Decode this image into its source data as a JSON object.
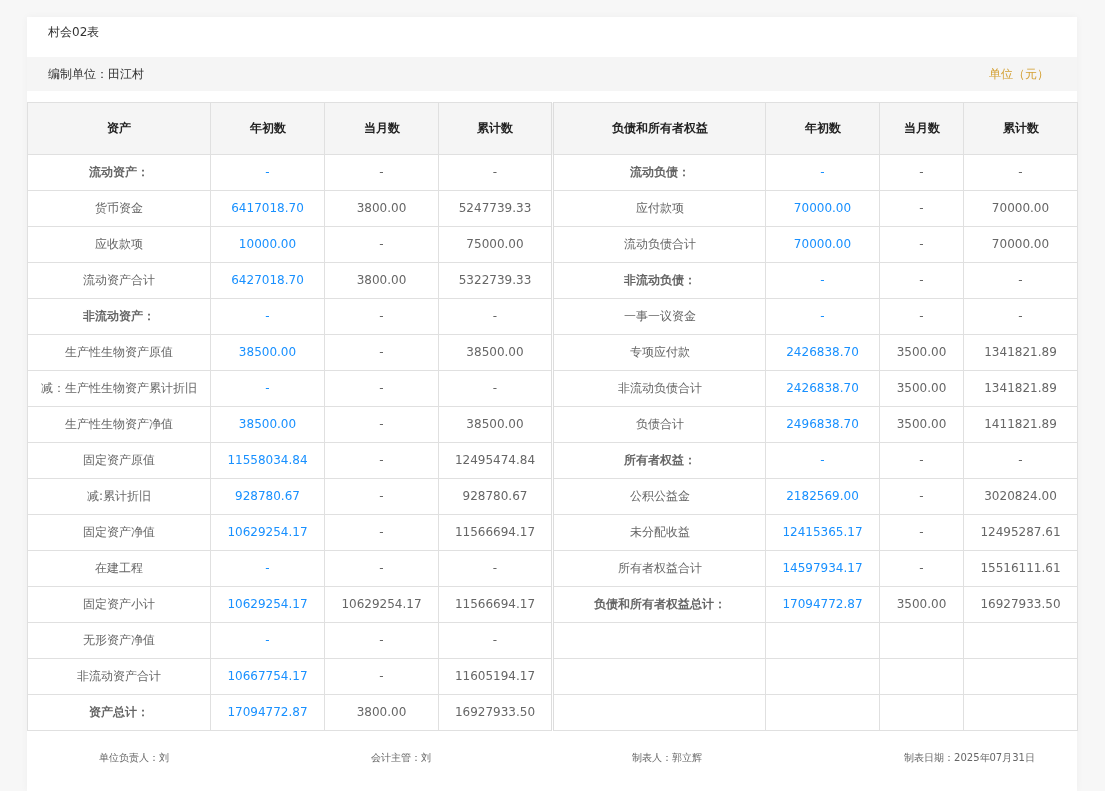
{
  "form_code": "村会02表",
  "unit_bar": {
    "org": "编制单位：田江村",
    "unit": "单位（元）"
  },
  "table": {
    "columns": [
      "资产",
      "年初数",
      "当月数",
      "累计数",
      "负债和所有者权益",
      "年初数",
      "当月数",
      "累计数"
    ],
    "rows": [
      {
        "left": {
          "label": "流动资产：",
          "bold": true,
          "values": [
            "-",
            "-",
            "-"
          ]
        },
        "right": {
          "label": "流动负债：",
          "bold": true,
          "values": [
            "-",
            "-",
            "-"
          ]
        }
      },
      {
        "left": {
          "label": "货币资金",
          "bold": false,
          "values": [
            "6417018.70",
            "3800.00",
            "5247739.33"
          ]
        },
        "right": {
          "label": "应付款项",
          "bold": false,
          "values": [
            "70000.00",
            "-",
            "70000.00"
          ]
        }
      },
      {
        "left": {
          "label": "应收款项",
          "bold": false,
          "values": [
            "10000.00",
            "-",
            "75000.00"
          ]
        },
        "right": {
          "label": "流动负债合计",
          "bold": false,
          "values": [
            "70000.00",
            "-",
            "70000.00"
          ]
        }
      },
      {
        "left": {
          "label": "流动资产合计",
          "bold": false,
          "values": [
            "6427018.70",
            "3800.00",
            "5322739.33"
          ]
        },
        "right": {
          "label": "非流动负债：",
          "bold": true,
          "values": [
            "-",
            "-",
            "-"
          ]
        }
      },
      {
        "left": {
          "label": "非流动资产：",
          "bold": true,
          "values": [
            "-",
            "-",
            "-"
          ]
        },
        "right": {
          "label": "一事一议资金",
          "bold": false,
          "values": [
            "-",
            "-",
            "-"
          ]
        }
      },
      {
        "left": {
          "label": "生产性生物资产原值",
          "bold": false,
          "values": [
            "38500.00",
            "-",
            "38500.00"
          ]
        },
        "right": {
          "label": "专项应付款",
          "bold": false,
          "values": [
            "2426838.70",
            "3500.00",
            "1341821.89"
          ]
        }
      },
      {
        "left": {
          "label": "减：生产性生物资产累计折旧",
          "bold": false,
          "values": [
            "-",
            "-",
            "-"
          ]
        },
        "right": {
          "label": "非流动负债合计",
          "bold": false,
          "values": [
            "2426838.70",
            "3500.00",
            "1341821.89"
          ]
        }
      },
      {
        "left": {
          "label": "生产性生物资产净值",
          "bold": false,
          "values": [
            "38500.00",
            "-",
            "38500.00"
          ]
        },
        "right": {
          "label": "负债合计",
          "bold": false,
          "values": [
            "2496838.70",
            "3500.00",
            "1411821.89"
          ]
        }
      },
      {
        "left": {
          "label": "固定资产原值",
          "bold": false,
          "values": [
            "11558034.84",
            "-",
            "12495474.84"
          ]
        },
        "right": {
          "label": "所有者权益：",
          "bold": true,
          "values": [
            "-",
            "-",
            "-"
          ]
        }
      },
      {
        "left": {
          "label": "减:累计折旧",
          "bold": false,
          "values": [
            "928780.67",
            "-",
            "928780.67"
          ]
        },
        "right": {
          "label": "公积公益金",
          "bold": false,
          "values": [
            "2182569.00",
            "-",
            "3020824.00"
          ]
        }
      },
      {
        "left": {
          "label": "固定资产净值",
          "bold": false,
          "values": [
            "10629254.17",
            "-",
            "11566694.17"
          ]
        },
        "right": {
          "label": "未分配收益",
          "bold": false,
          "values": [
            "12415365.17",
            "-",
            "12495287.61"
          ]
        }
      },
      {
        "left": {
          "label": "在建工程",
          "bold": false,
          "values": [
            "-",
            "-",
            "-"
          ]
        },
        "right": {
          "label": "所有者权益合计",
          "bold": false,
          "values": [
            "14597934.17",
            "-",
            "15516111.61"
          ]
        }
      },
      {
        "left": {
          "label": "固定资产小计",
          "bold": false,
          "values": [
            "10629254.17",
            "10629254.17",
            "11566694.17"
          ]
        },
        "right": {
          "label": "负债和所有者权益总计：",
          "bold": true,
          "values": [
            "17094772.87",
            "3500.00",
            "16927933.50"
          ]
        }
      },
      {
        "left": {
          "label": "无形资产净值",
          "bold": false,
          "values": [
            "-",
            "-",
            "-"
          ]
        }
      },
      {
        "left": {
          "label": "非流动资产合计",
          "bold": false,
          "values": [
            "10667754.17",
            "-",
            "11605194.17"
          ]
        }
      },
      {
        "left": {
          "label": "资产总计：",
          "bold": true,
          "values": [
            "17094772.87",
            "3800.00",
            "16927933.50"
          ]
        }
      }
    ]
  },
  "footer": [
    "单位负责人：刘",
    "会计主管：刘",
    "制表人：郭立辉",
    "制表日期：2025年07月31日"
  ]
}
